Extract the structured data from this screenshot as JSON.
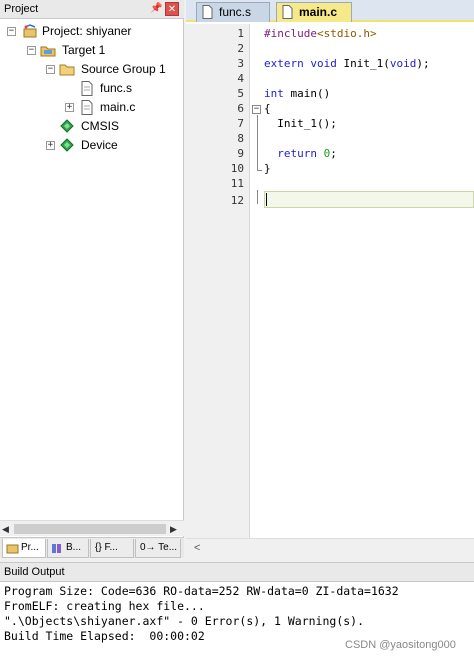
{
  "project_panel": {
    "title": "Project",
    "pin_icon": "pin-icon",
    "close_icon": "close-icon",
    "tree": [
      {
        "label": "Project: shiyaner",
        "icon": "project-icon",
        "expander": "−"
      },
      {
        "label": "Target 1",
        "icon": "target-icon",
        "expander": "−"
      },
      {
        "label": "Source Group 1",
        "icon": "folder-icon",
        "expander": "−"
      },
      {
        "label": "func.s",
        "icon": "file-icon",
        "expander": ""
      },
      {
        "label": "main.c",
        "icon": "file-icon",
        "expander": "+"
      },
      {
        "label": "CMSIS",
        "icon": "gem-icon",
        "expander": ""
      },
      {
        "label": "Device",
        "icon": "gem-icon",
        "expander": "+"
      }
    ],
    "tabs": [
      {
        "label": "Pr...",
        "icon": "project-tab-icon"
      },
      {
        "label": "B...",
        "icon": "books-tab-icon"
      },
      {
        "label": "{} F...",
        "icon": "functions-tab-icon"
      },
      {
        "label": "0→ Te...",
        "icon": "templates-tab-icon"
      }
    ]
  },
  "editor": {
    "tabs": [
      {
        "label": "func.s",
        "active": false
      },
      {
        "label": "main.c",
        "active": true
      }
    ],
    "line_numbers": [
      "1",
      "2",
      "3",
      "4",
      "5",
      "6",
      "7",
      "8",
      "9",
      "10",
      "11",
      "12"
    ],
    "code": {
      "l1_pp": "#include",
      "l1_inc": "<stdio.h>",
      "l3_kw1": "extern",
      "l3_kw2": "void",
      "l3_fn": " Init_1(",
      "l3_kw3": "void",
      "l3_end": ");",
      "l5_kw": "int",
      "l5_rest": " main()",
      "l6": "{",
      "l7": "  Init_1();",
      "l9_kw": "  return",
      "l9_num": " 0",
      "l9_end": ";",
      "l10": "}"
    }
  },
  "build_output": {
    "title": "Build Output",
    "lines": [
      "Program Size: Code=636 RO-data=252 RW-data=0 ZI-data=1632",
      "FromELF: creating hex file...",
      "\".\\Objects\\shiyaner.axf\" - 0 Error(s), 1 Warning(s).",
      "Build Time Elapsed:  00:00:02"
    ],
    "watermark": "CSDN @yaositong000"
  },
  "colors": {
    "active_tab": "#f6e98a",
    "keyword": "#1d1dd8",
    "number": "#1d9b1d"
  }
}
